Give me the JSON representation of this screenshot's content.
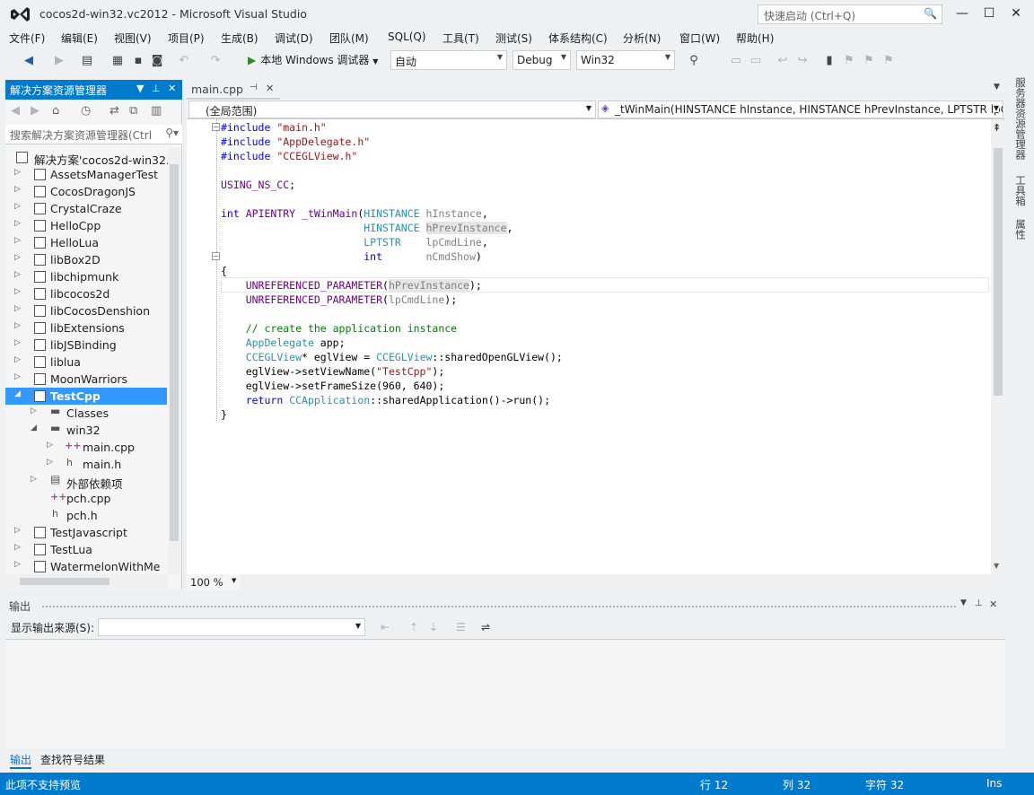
{
  "window": {
    "title": "cocos2d-win32.vc2012 - Microsoft Visual Studio",
    "quick_launch_placeholder": "快速启动 (Ctrl+Q)"
  },
  "menu": [
    "文件(F)",
    "编辑(E)",
    "视图(V)",
    "项目(P)",
    "生成(B)",
    "调试(D)",
    "团队(M)",
    "SQL(Q)",
    "工具(T)",
    "测试(S)",
    "体系结构(C)",
    "分析(N)",
    "窗口(W)",
    "帮助(H)"
  ],
  "toolbar": {
    "run_label": "本地 Windows 调试器",
    "config_value": "自动",
    "build_config": "Debug",
    "platform": "Win32"
  },
  "solution_explorer": {
    "title": "解决方案资源管理器",
    "search_placeholder": "搜索解决方案资源管理器(Ctrl",
    "items": [
      {
        "label": "解决方案'cocos2d-win32.v",
        "kind": "solution"
      },
      {
        "label": "AssetsManagerTest",
        "kind": "project"
      },
      {
        "label": "CocosDragonJS",
        "kind": "project"
      },
      {
        "label": "CrystalCraze",
        "kind": "project"
      },
      {
        "label": "HelloCpp",
        "kind": "project"
      },
      {
        "label": "HelloLua",
        "kind": "project"
      },
      {
        "label": "libBox2D",
        "kind": "project"
      },
      {
        "label": "libchipmunk",
        "kind": "project"
      },
      {
        "label": "libcocos2d",
        "kind": "project"
      },
      {
        "label": "libCocosDenshion",
        "kind": "project"
      },
      {
        "label": "libExtensions",
        "kind": "project"
      },
      {
        "label": "libJSBinding",
        "kind": "project"
      },
      {
        "label": "liblua",
        "kind": "project"
      },
      {
        "label": "MoonWarriors",
        "kind": "project"
      },
      {
        "label": "TestCpp",
        "kind": "project",
        "selected": true
      },
      {
        "label": "Classes",
        "kind": "folder"
      },
      {
        "label": "win32",
        "kind": "folder"
      },
      {
        "label": "main.cpp",
        "kind": "cpp"
      },
      {
        "label": "main.h",
        "kind": "h"
      },
      {
        "label": "外部依赖项",
        "kind": "folder"
      },
      {
        "label": "pch.cpp",
        "kind": "cpp"
      },
      {
        "label": "pch.h",
        "kind": "h"
      },
      {
        "label": "TestJavascript",
        "kind": "project"
      },
      {
        "label": "TestLua",
        "kind": "project"
      },
      {
        "label": "WatermelonWithMe",
        "kind": "project"
      }
    ]
  },
  "editor": {
    "tab_label": "main.cpp",
    "scope": "(全局范围)",
    "function": "_tWinMain(HINSTANCE hInstance, HINSTANCE hPrevInstance, LPTSTR lpC",
    "zoom": "100 %"
  },
  "right_rail": [
    "服务器资源管理器",
    "工具箱",
    "属性"
  ],
  "output": {
    "title": "输出",
    "source_label": "显示输出来源(S):",
    "tabs": [
      "输出",
      "查找符号结果"
    ]
  },
  "status": {
    "message": "此项不支持预览",
    "line": "行 12",
    "col": "列 32",
    "ch": "字符 32",
    "mode": "Ins"
  }
}
